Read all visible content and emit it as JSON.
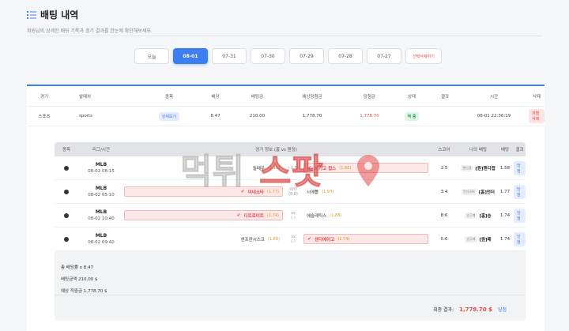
{
  "header": {
    "title": "배팅 내역",
    "subtitle": "회원님의 상세한 배팅 기록과 경기 결과를 한눈에 확인해보세요."
  },
  "date_tabs": [
    {
      "label": "오늘"
    },
    {
      "label": "08-01",
      "active": true
    },
    {
      "label": "07-31"
    },
    {
      "label": "07-30"
    },
    {
      "label": "07-29"
    },
    {
      "label": "07-28"
    },
    {
      "label": "07-27"
    },
    {
      "label": "선택삭제하기"
    }
  ],
  "summary": {
    "headers": [
      "경기",
      "발매차",
      "종목",
      "배당",
      "배팅금",
      "예상당첨금",
      "당첨금",
      "상태",
      "결과",
      "시간",
      "삭제"
    ],
    "row": {
      "game": "스포츠",
      "type": "sports",
      "detail": "상세보기",
      "odds": "8.47",
      "bet": "210.00",
      "expected": "1,778.70",
      "win": "1,778.70",
      "status": "적 중",
      "result": "",
      "time": "08-01 22:36:19",
      "delete": "개별삭제"
    }
  },
  "detail": {
    "headers": [
      "종목",
      "리그/시간",
      "경기 정보 (홈 vs 원정)",
      "스코어",
      "나의 배팅",
      "배당",
      "결과"
    ],
    "rows": [
      {
        "league": "MLB",
        "time": "08-02 08:15",
        "home": "필페우",
        "home_odds": "(2.15)",
        "vs": "(-1.5)",
        "away": "시카고 컵스",
        "away_odds": "(1.66)",
        "sel": "away",
        "score": "2:5",
        "pick_tag": "핸디캡",
        "pick": "[원]핸디캡",
        "odds": "1.58",
        "result": "당첨"
      },
      {
        "league": "MLB",
        "time": "08-02 05:10",
        "home": "미네소타",
        "home_odds": "(1.77)",
        "vs": "(8.0)",
        "vs_top": "U/O",
        "away": "시애틀",
        "away_odds": "(1.93)",
        "sel": "home",
        "score": "3:4",
        "pick_tag": "언더오버",
        "pick": "[홈]언더",
        "odds": "1.77",
        "result": "당첨"
      },
      {
        "league": "MLB",
        "time": "08-02 10:40",
        "home": "디트로이트",
        "home_odds": "(1.74)",
        "vs": "(-)",
        "vs_top": "vs",
        "away": "애슬레틱스",
        "away_odds": "(1.88)",
        "sel": "home",
        "score": "8:6",
        "pick_tag": "승무패",
        "pick": "[홈]승",
        "odds": "1.74",
        "result": "당첨"
      },
      {
        "league": "MLB",
        "time": "08-02 09:40",
        "home": "샌프란시스코",
        "home_odds": "(1.88)",
        "vs": "(-)",
        "vs_top": "vs",
        "away": "샌디에이고",
        "away_odds": "(1.74)",
        "sel": "away",
        "score": "5:6",
        "pick_tag": "승무패",
        "pick": "[원]패",
        "odds": "1.74",
        "result": "당첨"
      }
    ],
    "total_odds": "총 배당률 x 8.47",
    "bet_amount": "배팅금액 210.00 $",
    "expected": "예상 적중금 1,778.70 $",
    "final_label": "최종 결과:",
    "final_amount": "1,778.70 $",
    "final_result": "당첨"
  },
  "watermark": "먹튀스팟",
  "colors": {
    "accent": "#3d7ef0",
    "win": "#e24a4a",
    "success": "#2a9c51"
  }
}
